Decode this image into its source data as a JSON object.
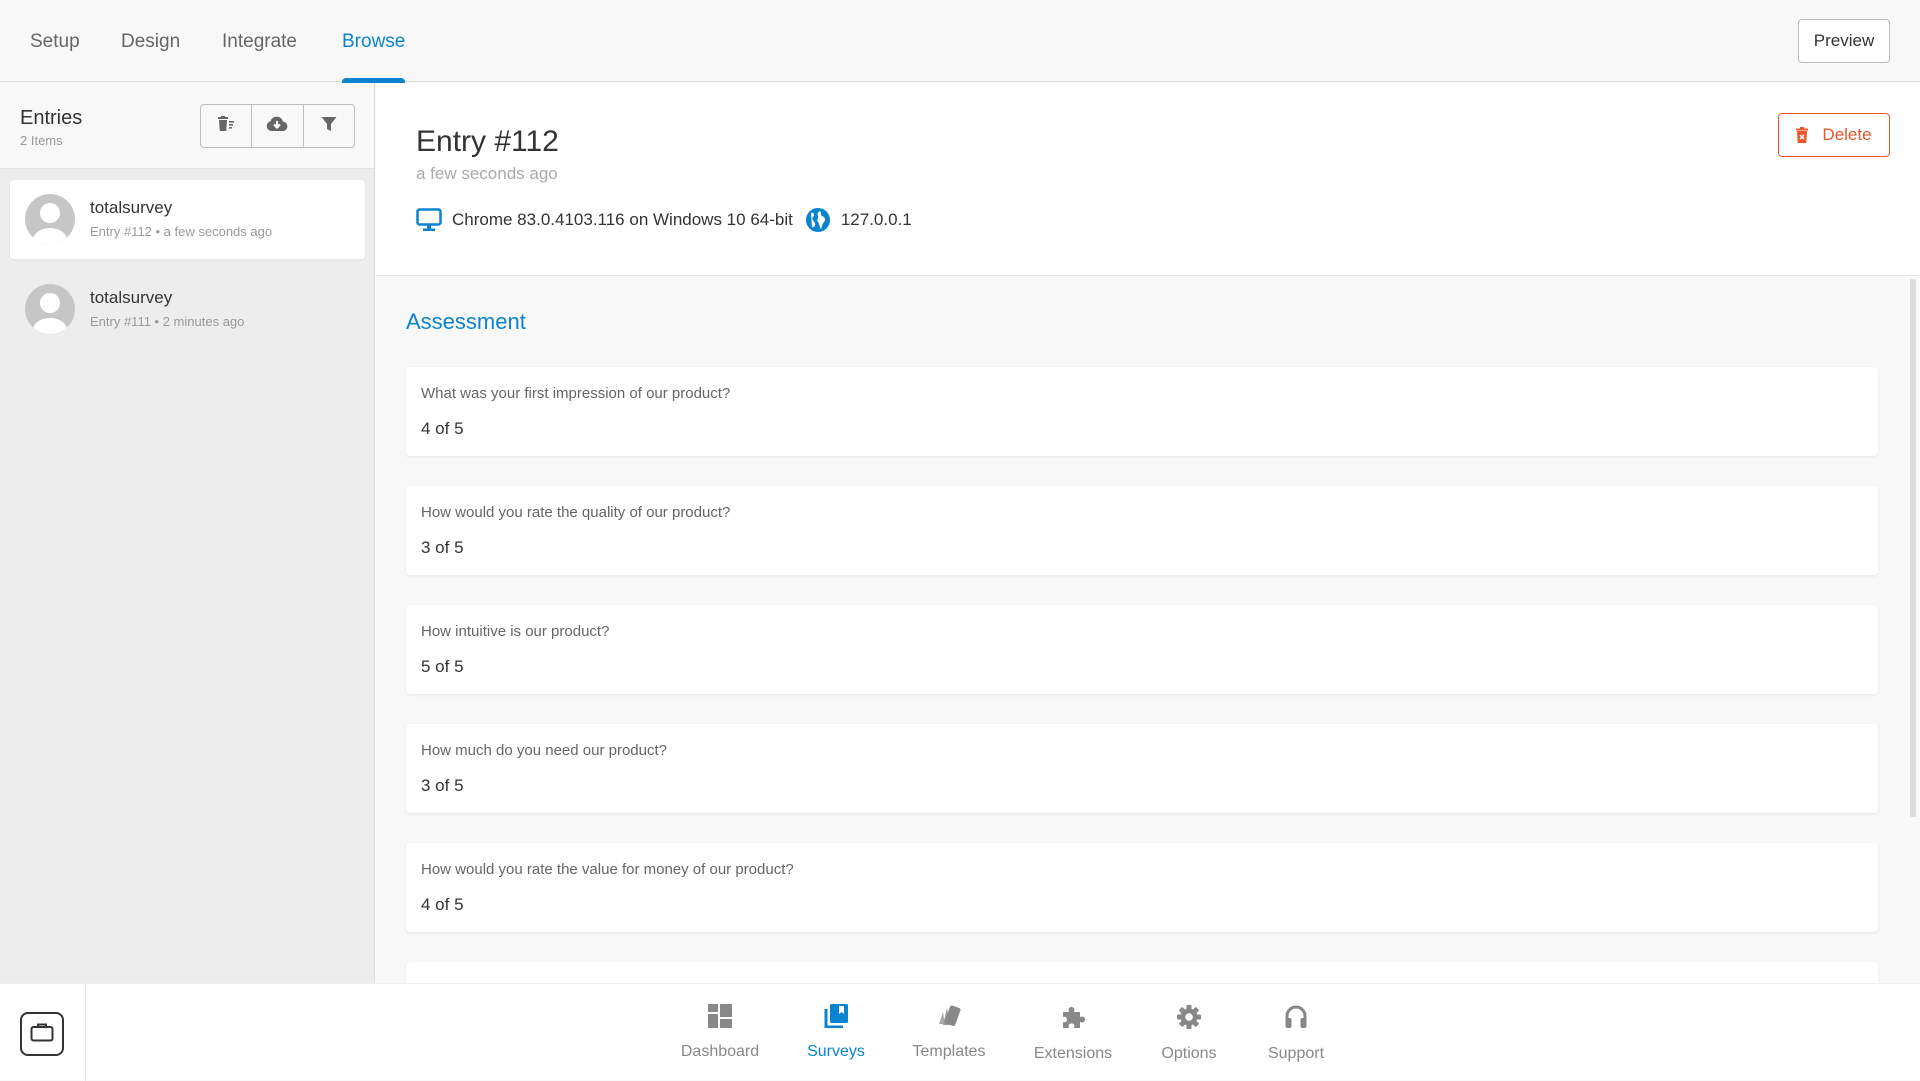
{
  "topnav": {
    "tabs": [
      {
        "label": "Setup",
        "active": false
      },
      {
        "label": "Design",
        "active": false
      },
      {
        "label": "Integrate",
        "active": false
      },
      {
        "label": "Browse",
        "active": true
      }
    ],
    "preview_label": "Preview"
  },
  "sidebar": {
    "title": "Entries",
    "count": "2 Items",
    "toolbar": [
      {
        "icon": "trash-list-icon"
      },
      {
        "icon": "cloud-download-icon"
      },
      {
        "icon": "filter-icon"
      }
    ],
    "entries": [
      {
        "name": "totalsurvey",
        "meta": "Entry #112 • a few seconds ago",
        "active": true
      },
      {
        "name": "totalsurvey",
        "meta": "Entry #111 • 2 minutes ago",
        "active": false
      }
    ]
  },
  "detail": {
    "title": "Entry #112",
    "time": "a few seconds ago",
    "device": "Chrome 83.0.4103.116 on Windows 10 64-bit",
    "ip": "127.0.0.1",
    "delete_label": "Delete"
  },
  "section": {
    "title": "Assessment",
    "questions": [
      {
        "question": "What was your first impression of our product?",
        "answer": "4 of 5"
      },
      {
        "question": "How would you rate the quality of our product?",
        "answer": "3 of 5"
      },
      {
        "question": "How intuitive is our product?",
        "answer": "5 of 5"
      },
      {
        "question": "How much do you need our product?",
        "answer": "3 of 5"
      },
      {
        "question": "How would you rate the value for money of our product?",
        "answer": "4 of 5"
      },
      {
        "question": "",
        "answer": ""
      }
    ]
  },
  "bottomnav": {
    "items": [
      {
        "label": "Dashboard",
        "icon": "dashboard-icon",
        "active": false
      },
      {
        "label": "Surveys",
        "icon": "surveys-icon",
        "active": true
      },
      {
        "label": "Templates",
        "icon": "templates-icon",
        "active": false
      },
      {
        "label": "Extensions",
        "icon": "puzzle-icon",
        "active": false
      },
      {
        "label": "Options",
        "icon": "gear-icon",
        "active": false
      },
      {
        "label": "Support",
        "icon": "headphones-icon",
        "active": false
      }
    ]
  },
  "colors": {
    "accent": "#0a84d0",
    "danger": "#e8562a",
    "icon_gray": "#888888"
  }
}
